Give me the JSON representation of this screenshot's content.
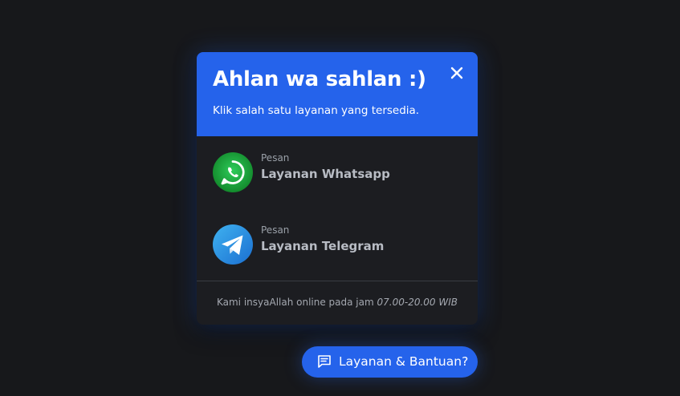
{
  "popup": {
    "title": "Ahlan wa sahlan :)",
    "subtitle": "Klik salah satu layanan yang tersedia.",
    "close_icon": "close-icon",
    "contacts": [
      {
        "small_label": "Pesan",
        "name": "Layanan Whatsapp",
        "icon": "whatsapp-icon",
        "icon_color": "#25d366"
      },
      {
        "small_label": "Pesan",
        "name": "Layanan Telegram",
        "icon": "telegram-icon",
        "icon_color": "#2aa3e8"
      }
    ],
    "footer_prefix": "Kami insyaAllah online pada jam",
    "footer_hours": "07.00-20.00 WIB"
  },
  "help_button": {
    "label": "Layanan & Bantuan?",
    "icon": "chat-icon"
  },
  "colors": {
    "accent": "#2563eb",
    "background": "#17181b",
    "panel": "#1c1d21"
  }
}
